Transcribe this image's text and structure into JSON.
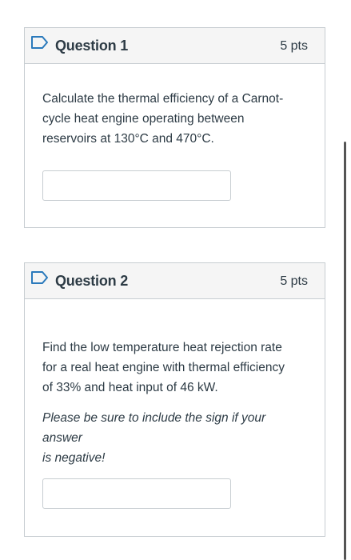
{
  "questions": [
    {
      "title": "Question 1",
      "points": "5 pts",
      "text_lines": [
        "Calculate the thermal efficiency of a Carnot-",
        "cycle heat engine operating between",
        "reservoirs at 130°C and 470°C."
      ],
      "answer_value": ""
    },
    {
      "title": "Question 2",
      "points": "5 pts",
      "text_lines": [
        "Find the low temperature heat rejection rate",
        "for a real heat engine with thermal efficiency",
        "of 33% and heat input of 46 kW."
      ],
      "note_lines": [
        "Please be sure to include the sign if your answer",
        "is negative!"
      ],
      "answer_value": ""
    }
  ],
  "colors": {
    "flag_icon": "#2b7abc",
    "border": "#c7cdd1",
    "header_bg": "#f5f5f5",
    "text": "#2d3b45"
  },
  "icons": {
    "flag": "flag-icon"
  }
}
